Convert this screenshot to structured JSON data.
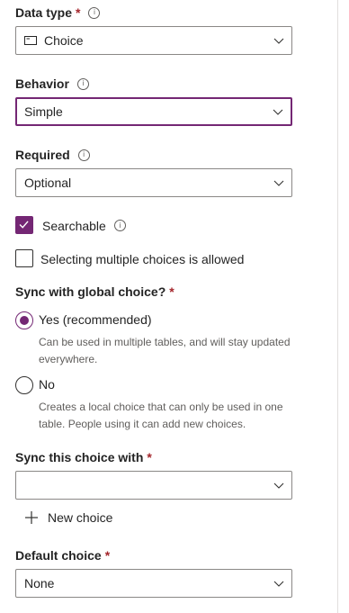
{
  "data_type": {
    "label": "Data type",
    "required_mark": "*",
    "value": "Choice",
    "icon": "choice-type-icon"
  },
  "behavior": {
    "label": "Behavior",
    "value": "Simple"
  },
  "required": {
    "label": "Required",
    "value": "Optional"
  },
  "searchable": {
    "label": "Searchable",
    "checked": true
  },
  "multi_select": {
    "label": "Selecting multiple choices is allowed",
    "checked": false
  },
  "sync_global": {
    "label": "Sync with global choice?",
    "required_mark": "*",
    "options": [
      {
        "label": "Yes (recommended)",
        "description": "Can be used in multiple tables, and will stay updated everywhere.",
        "selected": true
      },
      {
        "label": "No",
        "description": "Creates a local choice that can only be used in one table. People using it can add new choices.",
        "selected": false
      }
    ]
  },
  "sync_with": {
    "label": "Sync this choice with",
    "required_mark": "*",
    "value": "",
    "new_choice_label": "New choice"
  },
  "default_choice": {
    "label": "Default choice",
    "required_mark": "*",
    "value": "None"
  },
  "colors": {
    "accent": "#742774",
    "required": "#a4262c",
    "border": "#8a8886",
    "secondary_text": "#605e5c"
  }
}
